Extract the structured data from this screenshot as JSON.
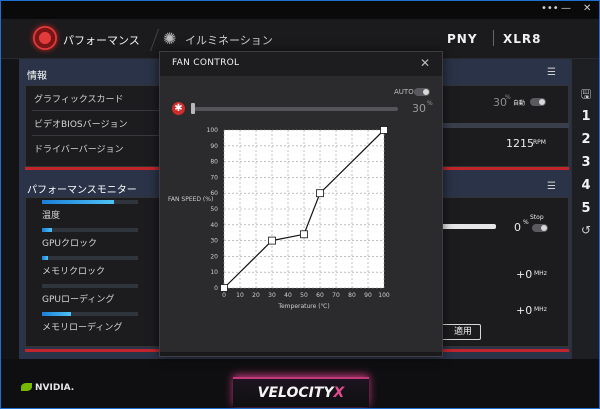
{
  "window": {
    "controls": [
      "•••",
      "—",
      "✕"
    ]
  },
  "nav": {
    "performance_tab": "パフォーマンス",
    "illumination_tab": "イルミネーション",
    "brand_pny": "PNY",
    "brand_xlr8": "XLR8"
  },
  "info": {
    "title": "情報",
    "rows": [
      "グラフィックスカード",
      "ビデオBIOSバージョン",
      "ドライバーバージョン"
    ]
  },
  "monitor": {
    "title": "パフォーマンスモニター",
    "rows": [
      {
        "label": "温度",
        "fill": 0.75
      },
      {
        "label": "GPUクロック",
        "fill": 0.1
      },
      {
        "label": "メモリクロック",
        "fill": 0.06
      },
      {
        "label": "GPUローディング",
        "fill": 0.0
      },
      {
        "label": "メモリローディング",
        "fill": 0.3
      }
    ]
  },
  "right_panel": {
    "fan_pct_value": "30",
    "fan_pct_unit": "%",
    "auto_label": "自動",
    "rpm_value": "1215",
    "rpm_unit": "RPM",
    "stop_label": "Stop",
    "fan_value": "0",
    "fan_value_unit": "%",
    "gpu_clock_offset": "+0",
    "gpu_clock_unit": "MHz",
    "mem_clock_offset": "+0",
    "mem_clock_unit": "MHz",
    "apply_label": "適用"
  },
  "profiles": [
    "1",
    "2",
    "3",
    "4",
    "5"
  ],
  "footer": {
    "nvidia": "NVIDIA.",
    "velocity": "VELOCITY",
    "velocity_x": "X"
  },
  "dialog": {
    "title": "FAN CONTROL",
    "auto_label": "AUTO",
    "slider_value": "30",
    "slider_unit": "%"
  },
  "chart_data": {
    "type": "line",
    "xlabel": "Temperature (℃)",
    "ylabel": "FAN SPEED (%)",
    "xlim": [
      0,
      100
    ],
    "ylim": [
      0,
      100
    ],
    "xticks": [
      0,
      10,
      20,
      30,
      40,
      50,
      60,
      70,
      80,
      90,
      100
    ],
    "yticks": [
      0,
      10,
      20,
      30,
      40,
      50,
      60,
      70,
      80,
      90,
      100
    ],
    "grid": true,
    "x": [
      0,
      30,
      50,
      60,
      100
    ],
    "y": [
      0,
      30,
      34,
      60,
      100
    ]
  },
  "colors": {
    "accent_red": "#c1252b",
    "accent_blue": "#4ec3f5",
    "nvidia_green": "#76b900",
    "velocity_pink": "#e04a8e"
  }
}
